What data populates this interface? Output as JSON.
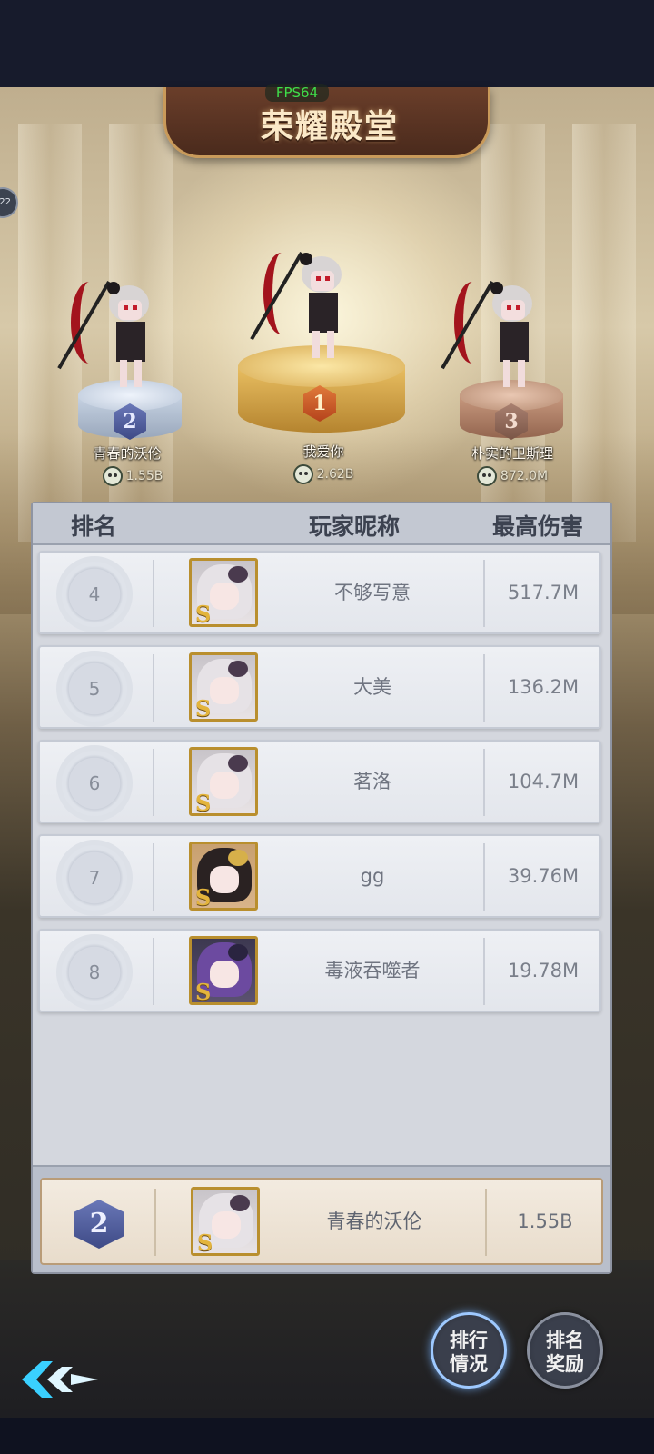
{
  "header": {
    "title": "荣耀殿堂",
    "fps": "FPS64",
    "side_badge": "22"
  },
  "podium": [
    {
      "rank": "2",
      "name": "青春的沃伦",
      "score": "1.55B"
    },
    {
      "rank": "1",
      "name": "我爱你",
      "score": "2.62B"
    },
    {
      "rank": "3",
      "name": "朴实的卫斯理",
      "score": "872.0M"
    }
  ],
  "table": {
    "columns": [
      "排名",
      "玩家昵称",
      "最高伤害"
    ],
    "rows": [
      {
        "rank": "4",
        "name": "不够写意",
        "damage": "517.7M"
      },
      {
        "rank": "5",
        "name": "大美",
        "damage": "136.2M"
      },
      {
        "rank": "6",
        "name": "茗洛",
        "damage": "104.7M"
      },
      {
        "rank": "7",
        "name": "gg",
        "damage": "39.76M"
      },
      {
        "rank": "8",
        "name": "毒液吞噬者",
        "damage": "19.78M"
      }
    ]
  },
  "self": {
    "rank": "2",
    "name": "青春的沃伦",
    "damage": "1.55B"
  },
  "buttons": {
    "ranking": "排行情况",
    "rewards": "排名奖励"
  },
  "colors": {
    "gold": "#d8ab52",
    "silver": "#b9c6d8",
    "bronze": "#b58a70",
    "board": "#d4d7de"
  }
}
